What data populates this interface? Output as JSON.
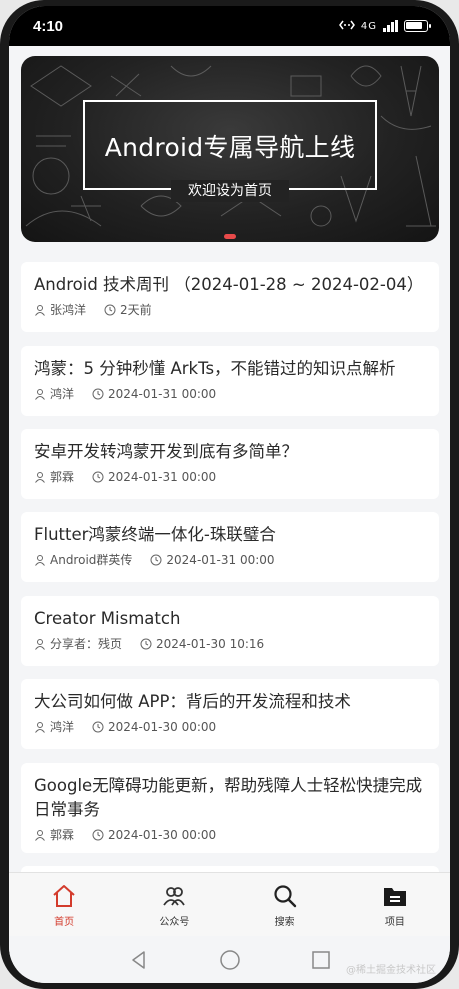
{
  "status_bar": {
    "time": "4:10",
    "network": "4G"
  },
  "banner": {
    "title": "Android专属导航上线",
    "subtitle": "欢迎设为首页",
    "active_dot_color": "#e84a4a"
  },
  "articles": [
    {
      "title": "Android 技术周刊 （2024-01-28 ~ 2024-02-04）",
      "author": "张鸿洋",
      "time": "2天前"
    },
    {
      "title": "鸿蒙：5 分钟秒懂 ArkTs，不能错过的知识点解析",
      "author": "鸿洋",
      "time": "2024-01-31 00:00"
    },
    {
      "title": "安卓开发转鸿蒙开发到底有多简单？",
      "author": "郭霖",
      "time": "2024-01-31 00:00"
    },
    {
      "title": "Flutter鸿蒙终端一体化-珠联璧合",
      "author": "Android群英传",
      "time": "2024-01-31 00:00"
    },
    {
      "title": "Creator Mismatch",
      "author": "分享者：残页",
      "time": "2024-01-30 10:16"
    },
    {
      "title": "大公司如何做 APP：背后的开发流程和技术",
      "author": "鸿洋",
      "time": "2024-01-30 00:00"
    },
    {
      "title": "Google无障碍功能更新，帮助残障人士轻松快捷完成日常事务",
      "author": "郭霖",
      "time": "2024-01-30 00:00"
    }
  ],
  "tabs": [
    {
      "label": "首页",
      "icon": "home-icon",
      "active": true
    },
    {
      "label": "公众号",
      "icon": "people-icon",
      "active": false
    },
    {
      "label": "搜索",
      "icon": "search-icon",
      "active": false
    },
    {
      "label": "项目",
      "icon": "folder-icon",
      "active": false
    }
  ],
  "colors": {
    "accent": "#d33b2c",
    "card_bg": "#ffffff",
    "page_bg": "#f4f5f7"
  },
  "watermark": "@稀土掘金技术社区"
}
